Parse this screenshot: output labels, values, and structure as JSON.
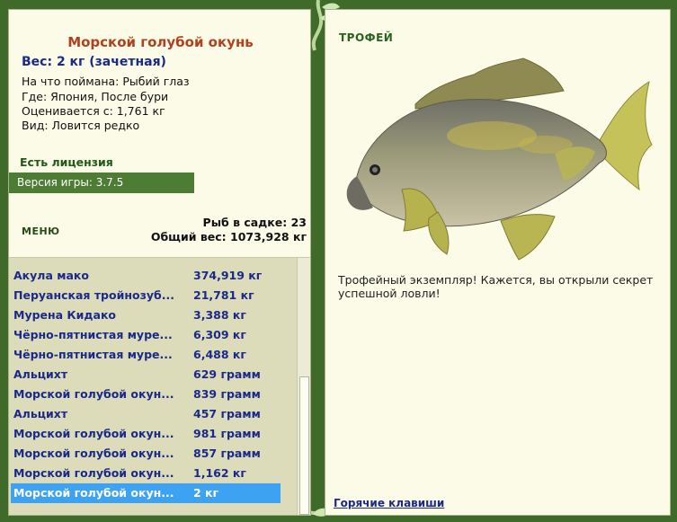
{
  "fish": {
    "title": "Морской голубой окунь",
    "weight_line": "Вес: 2 кг (зачетная)",
    "bait": "На что поймана: Рыбий глаз",
    "where": "Где: Япония, После бури",
    "value": "Оценивается с: 1,761 кг",
    "type": "Вид: Ловится редко"
  },
  "license": "Есть лицензия",
  "version": "Версия игры: 3.7.5",
  "menu_label": "МЕНЮ",
  "keepnet": {
    "count_line": "Рыб в садке: 23",
    "total_line": "Общий вес: 1073,928 кг"
  },
  "catch_list": [
    {
      "name": "Акула мако",
      "weight": "374,919 кг"
    },
    {
      "name": "Перуанская тройнозуб...",
      "weight": "21,781 кг"
    },
    {
      "name": "Мурена Кидако",
      "weight": "3,388 кг"
    },
    {
      "name": "Чёрно-пятнистая муре...",
      "weight": "6,309 кг"
    },
    {
      "name": "Чёрно-пятнистая муре...",
      "weight": "6,488 кг"
    },
    {
      "name": "Альцихт",
      "weight": "629 грамм"
    },
    {
      "name": "Морской голубой окун...",
      "weight": "839 грамм"
    },
    {
      "name": "Альцихт",
      "weight": "457 грамм"
    },
    {
      "name": "Морской голубой окун...",
      "weight": "981 грамм"
    },
    {
      "name": "Морской голубой окун...",
      "weight": "857 грамм"
    },
    {
      "name": "Морской голубой окун...",
      "weight": "1,162 кг"
    },
    {
      "name": "Морской голубой окун...",
      "weight": "2 кг"
    }
  ],
  "selected_index": 11,
  "trophy": {
    "label": "ТРОФЕЙ",
    "text": "Трофейный экземпляр! Кажется, вы открыли секрет успешной ловли!"
  },
  "hotkeys_link": "Горячие клавиши",
  "colors": {
    "frame": "#3f6a2a",
    "panel": "#fbfbe7",
    "list_bg": "#dcdcba",
    "selected": "#3ea2f3",
    "title": "#b1401f",
    "link": "#1b2a8a"
  }
}
